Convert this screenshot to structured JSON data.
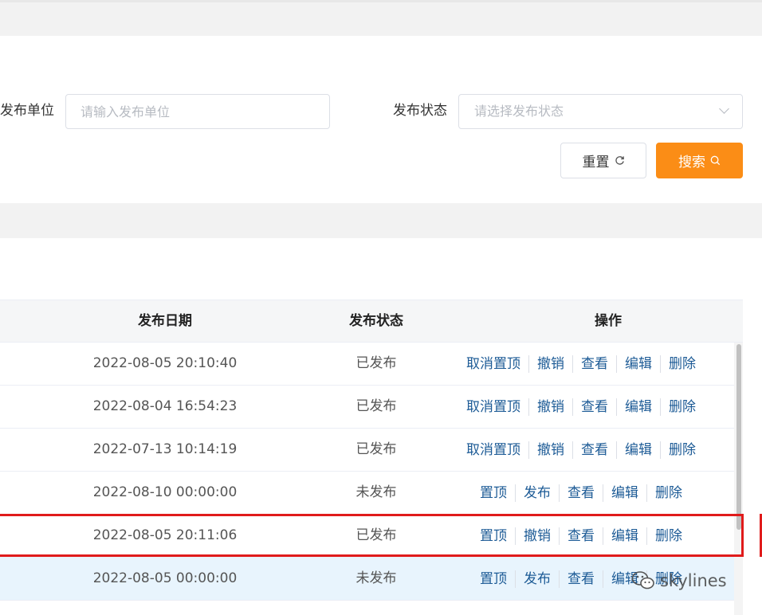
{
  "search": {
    "unit_label": "发布单位",
    "unit_placeholder": "请输入发布单位",
    "status_label": "发布状态",
    "status_placeholder": "请选择发布状态",
    "reset_label": "重置",
    "search_label": "搜索"
  },
  "table": {
    "columns": {
      "date": "发布日期",
      "status": "发布状态",
      "actions": "操作"
    },
    "rows": [
      {
        "date": "2022-08-05 20:10:40",
        "status": "已发布",
        "actions": [
          "取消置顶",
          "撤销",
          "查看",
          "编辑",
          "删除"
        ]
      },
      {
        "date": "2022-08-04 16:54:23",
        "status": "已发布",
        "actions": [
          "取消置顶",
          "撤销",
          "查看",
          "编辑",
          "删除"
        ]
      },
      {
        "date": "2022-07-13 10:14:19",
        "status": "已发布",
        "actions": [
          "取消置顶",
          "撤销",
          "查看",
          "编辑",
          "删除"
        ]
      },
      {
        "date": "2022-08-10 00:00:00",
        "status": "未发布",
        "actions": [
          "置顶",
          "发布",
          "查看",
          "编辑",
          "删除"
        ]
      },
      {
        "date": "2022-08-05 20:11:06",
        "status": "已发布",
        "actions": [
          "置顶",
          "撤销",
          "查看",
          "编辑",
          "删除"
        ]
      },
      {
        "date": "2022-08-05 00:00:00",
        "status": "未发布",
        "actions": [
          "置顶",
          "发布",
          "查看",
          "编辑",
          "删除"
        ]
      }
    ]
  },
  "watermark": {
    "text": "skylines",
    "icon": "wechat-icon"
  },
  "colors": {
    "accent": "#fb8d16",
    "link": "#1d5b96",
    "highlight_box": "#e01b1b",
    "selected_row": "#e8f4fd"
  }
}
